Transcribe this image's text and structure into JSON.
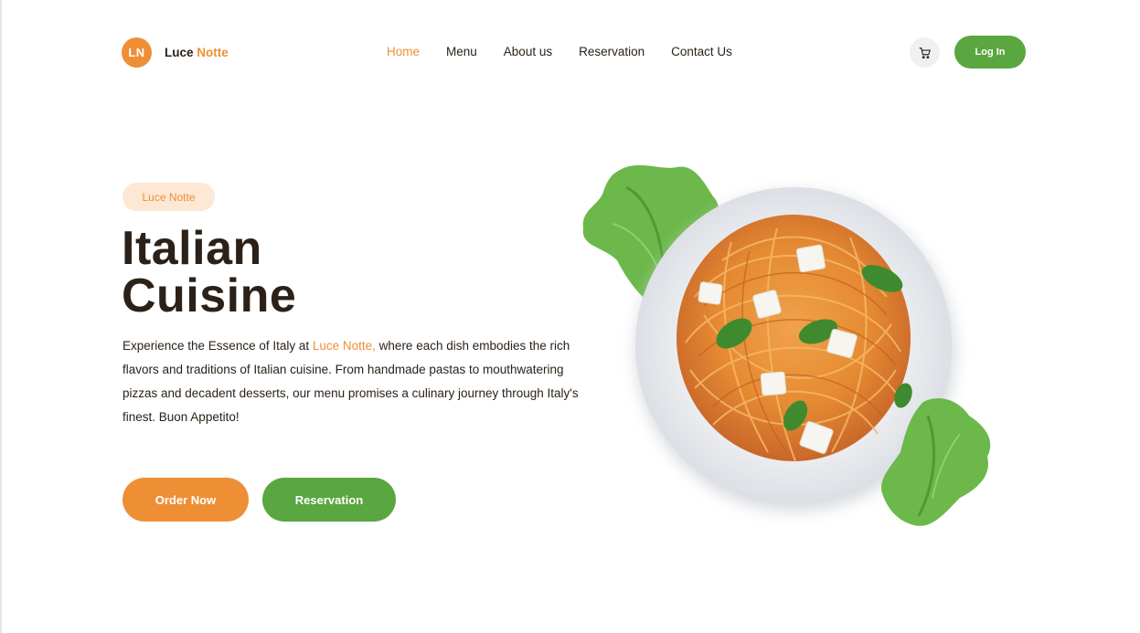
{
  "brand": {
    "badge": "LN",
    "name_first": "Luce",
    "name_second": "Notte"
  },
  "nav": {
    "items": [
      {
        "label": "Home",
        "active": true
      },
      {
        "label": "Menu",
        "active": false
      },
      {
        "label": "About us",
        "active": false
      },
      {
        "label": "Reservation",
        "active": false
      },
      {
        "label": "Contact Us",
        "active": false
      }
    ]
  },
  "header": {
    "cart_icon": "cart-icon",
    "login_label": "Log In"
  },
  "hero": {
    "tag": "Luce Notte",
    "title_line1": "Italian",
    "title_line2": "Cuisine",
    "desc_before": "Experience the Essence of Italy at ",
    "desc_highlight": "Luce Notte,",
    "desc_after": " where each dish embodies the rich flavors and traditions of Italian cuisine. From handmade pastas to mouthwatering pizzas and decadent desserts, our menu promises a culinary journey through Italy's finest. Buon Appetito!",
    "order_label": "Order Now",
    "reservation_label": "Reservation",
    "image_icon": "pasta-plate-image"
  },
  "colors": {
    "accent": "#ef8f35",
    "green": "#5aa640",
    "text": "#2b2118"
  }
}
